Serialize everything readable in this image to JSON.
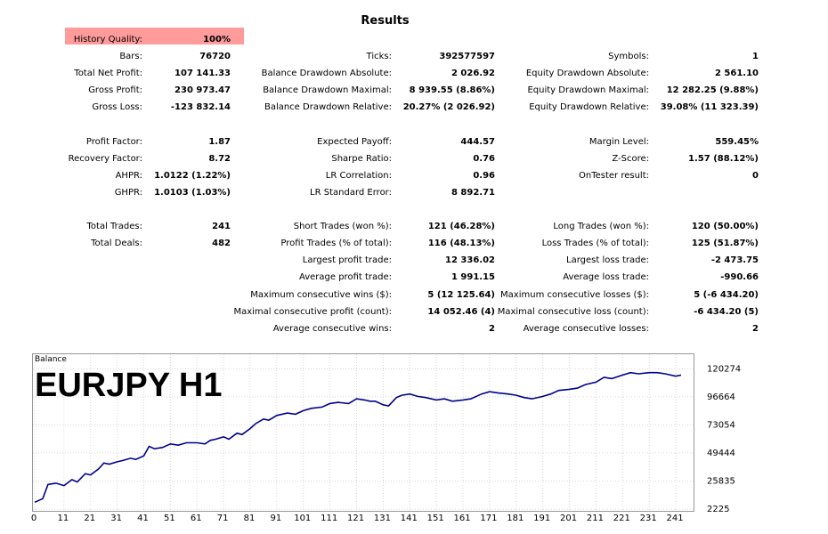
{
  "title": "Results",
  "stats": [
    {
      "label": "History Quality:",
      "value": "100%",
      "col": 1,
      "row": 0
    },
    {
      "label": "Bars:",
      "value": "76720",
      "col": 1,
      "row": 1
    },
    {
      "label": "Total Net Profit:",
      "value": "107 141.33",
      "col": 1,
      "row": 2
    },
    {
      "label": "Gross Profit:",
      "value": "230 973.47",
      "col": 1,
      "row": 3
    },
    {
      "label": "Gross Loss:",
      "value": "-123 832.14",
      "col": 1,
      "row": 4
    },
    {
      "label": "Profit Factor:",
      "value": "1.87",
      "col": 1,
      "row": 6
    },
    {
      "label": "Recovery Factor:",
      "value": "8.72",
      "col": 1,
      "row": 7
    },
    {
      "label": "AHPR:",
      "value": "1.0122 (1.22%)",
      "col": 1,
      "row": 8
    },
    {
      "label": "GHPR:",
      "value": "1.0103 (1.03%)",
      "col": 1,
      "row": 9
    },
    {
      "label": "Total Trades:",
      "value": "241",
      "col": 1,
      "row": 11
    },
    {
      "label": "Total Deals:",
      "value": "482",
      "col": 1,
      "row": 12
    },
    {
      "label": "Ticks:",
      "value": "392577597",
      "col": 2,
      "row": 1
    },
    {
      "label": "Balance Drawdown Absolute:",
      "value": "2 026.92",
      "col": 2,
      "row": 2
    },
    {
      "label": "Balance Drawdown Maximal:",
      "value": "8 939.55 (8.86%)",
      "col": 2,
      "row": 3
    },
    {
      "label": "Balance Drawdown Relative:",
      "value": "20.27% (2 026.92)",
      "col": 2,
      "row": 4
    },
    {
      "label": "Expected Payoff:",
      "value": "444.57",
      "col": 2,
      "row": 6
    },
    {
      "label": "Sharpe Ratio:",
      "value": "0.76",
      "col": 2,
      "row": 7
    },
    {
      "label": "LR Correlation:",
      "value": "0.96",
      "col": 2,
      "row": 8
    },
    {
      "label": "LR Standard Error:",
      "value": "8 892.71",
      "col": 2,
      "row": 9
    },
    {
      "label": "Short Trades (won %):",
      "value": "121 (46.28%)",
      "col": 2,
      "row": 11
    },
    {
      "label": "Profit Trades (% of total):",
      "value": "116 (48.13%)",
      "col": 2,
      "row": 12
    },
    {
      "label": "Largest profit trade:",
      "value": "12 336.02",
      "col": 2,
      "row": 13
    },
    {
      "label": "Average profit trade:",
      "value": "1 991.15",
      "col": 2,
      "row": 14
    },
    {
      "label": "Maximum consecutive wins ($):",
      "value": "5 (12 125.64)",
      "col": 2,
      "row": 15
    },
    {
      "label": "Maximal consecutive profit (count):",
      "value": "14 052.46 (4)",
      "col": 2,
      "row": 16
    },
    {
      "label": "Average consecutive wins:",
      "value": "2",
      "col": 2,
      "row": 17
    },
    {
      "label": "Symbols:",
      "value": "1",
      "col": 3,
      "row": 1
    },
    {
      "label": "Equity Drawdown Absolute:",
      "value": "2 561.10",
      "col": 3,
      "row": 2
    },
    {
      "label": "Equity Drawdown Maximal:",
      "value": "12 282.25 (9.88%)",
      "col": 3,
      "row": 3
    },
    {
      "label": "Equity Drawdown Relative:",
      "value": "39.08% (11 323.39)",
      "col": 3,
      "row": 4
    },
    {
      "label": "Margin Level:",
      "value": "559.45%",
      "col": 3,
      "row": 6
    },
    {
      "label": "Z-Score:",
      "value": "1.57 (88.12%)",
      "col": 3,
      "row": 7
    },
    {
      "label": "OnTester result:",
      "value": "0",
      "col": 3,
      "row": 8
    },
    {
      "label": "Long Trades (won %):",
      "value": "120 (50.00%)",
      "col": 3,
      "row": 11
    },
    {
      "label": "Loss Trades (% of total):",
      "value": "125 (51.87%)",
      "col": 3,
      "row": 12
    },
    {
      "label": "Largest loss trade:",
      "value": "-2 473.75",
      "col": 3,
      "row": 13
    },
    {
      "label": "Average loss trade:",
      "value": "-990.66",
      "col": 3,
      "row": 14
    },
    {
      "label": "Maximum consecutive losses ($):",
      "value": "5 (-6 434.20)",
      "col": 3,
      "row": 15
    },
    {
      "label": "Maximal consecutive loss (count):",
      "value": "-6 434.20 (5)",
      "col": 3,
      "row": 16
    },
    {
      "label": "Average consecutive losses:",
      "value": "2",
      "col": 3,
      "row": 17
    }
  ],
  "highlight_color": "#ff9b9b",
  "chart_data": {
    "type": "line",
    "title": "Balance",
    "annotation": "EURJPY H1",
    "line_color": "#00008b",
    "grid": true,
    "xlim": [
      0,
      245
    ],
    "ylim": [
      2225,
      128000
    ],
    "x_ticks": [
      0,
      11,
      21,
      31,
      41,
      51,
      61,
      71,
      81,
      91,
      101,
      111,
      121,
      131,
      141,
      151,
      161,
      171,
      181,
      191,
      201,
      211,
      221,
      231,
      241
    ],
    "y_ticks": [
      2225,
      25835,
      49444,
      73054,
      96664,
      120274
    ],
    "x": [
      0,
      3,
      5,
      8,
      11,
      14,
      16,
      19,
      21,
      24,
      26,
      28,
      31,
      33,
      36,
      38,
      41,
      43,
      45,
      48,
      51,
      54,
      57,
      61,
      64,
      66,
      68,
      71,
      73,
      76,
      78,
      81,
      83,
      86,
      88,
      91,
      95,
      98,
      101,
      104,
      108,
      111,
      114,
      118,
      121,
      124,
      126,
      128,
      131,
      133,
      136,
      138,
      141,
      144,
      147,
      151,
      154,
      157,
      161,
      164,
      168,
      171,
      174,
      178,
      181,
      184,
      187,
      191,
      194,
      197,
      201,
      204,
      207,
      211,
      214,
      217,
      221,
      224,
      227,
      231,
      234,
      237,
      241,
      243
    ],
    "y": [
      8000,
      11000,
      23000,
      24000,
      22000,
      27000,
      25000,
      32000,
      31000,
      36000,
      41000,
      40000,
      42000,
      43000,
      45000,
      44000,
      47000,
      55000,
      53000,
      54000,
      57000,
      56000,
      58000,
      58000,
      57000,
      60000,
      61000,
      63000,
      61000,
      66000,
      65000,
      70000,
      74000,
      78000,
      77000,
      81000,
      83000,
      82000,
      85000,
      87000,
      88000,
      91000,
      92000,
      91000,
      95000,
      94000,
      93000,
      93000,
      90000,
      89000,
      96000,
      98000,
      99000,
      97000,
      96000,
      94000,
      95000,
      93000,
      94000,
      95000,
      99000,
      101000,
      100000,
      99000,
      98000,
      96000,
      95000,
      97000,
      99000,
      102000,
      103000,
      104000,
      107000,
      109000,
      113000,
      112000,
      115000,
      117000,
      116000,
      117000,
      117000,
      116000,
      114000,
      115000
    ]
  }
}
